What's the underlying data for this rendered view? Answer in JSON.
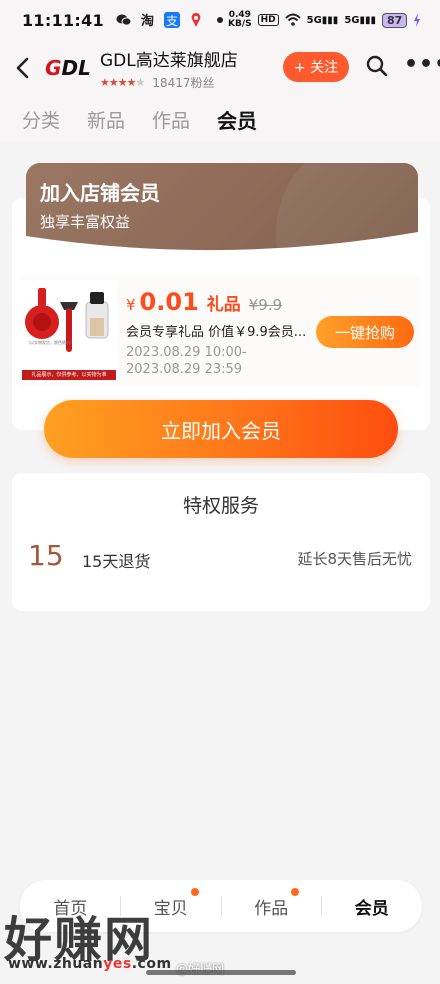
{
  "status_bar": {
    "time": "11:11:41",
    "speed_value": "0.49",
    "speed_unit": "KB/S",
    "hd": "HD",
    "signal1": "5G",
    "signal2": "5G",
    "battery": "87"
  },
  "header": {
    "back_icon": "chevron-left-icon",
    "logo_text_g": "G",
    "logo_text_dl": "DL",
    "store_name": "GDL高达莱旗舰店",
    "stars_filled": "★★★★",
    "stars_empty": "★",
    "fans": "18417粉丝",
    "follow_label": "+ 关注",
    "more": "•••"
  },
  "tabs": [
    {
      "label": "分类"
    },
    {
      "label": "新品"
    },
    {
      "label": "作品"
    },
    {
      "label": "会员"
    }
  ],
  "member": {
    "title": "加入店铺会员",
    "subtitle": "独享丰富权益",
    "gift": {
      "yen": "¥",
      "price": "0.01",
      "label": "礼品",
      "original_price": "¥9.9",
      "description": "会员专享礼品 价值￥9.9会员...",
      "time": "2023.08.29 10:00-2023.08.29 23:59",
      "grab_label": "一键抢购",
      "caption": "礼品展示，仅供参考，以实物为准",
      "small_text": "（以实物发货，颜色随机）"
    },
    "join_label": "立即加入会员"
  },
  "privileges": {
    "title": "特权服务",
    "items": [
      {
        "num": "15",
        "name": "15天退货",
        "desc": "延长8天售后无忧"
      }
    ]
  },
  "bottom_nav": {
    "items": [
      {
        "label": "首页"
      },
      {
        "label": "宝贝"
      },
      {
        "label": "作品"
      },
      {
        "label": "会员"
      }
    ]
  },
  "watermark": {
    "text": "好赚网",
    "url_prefix": "www.zhuan",
    "url_highlight": "yes",
    "url_suffix": ".com",
    "weibo": "@好赚网"
  },
  "colors": {
    "accent": "#ff5a2e",
    "price": "#ff4a1a",
    "banner": "#8c6a57"
  }
}
